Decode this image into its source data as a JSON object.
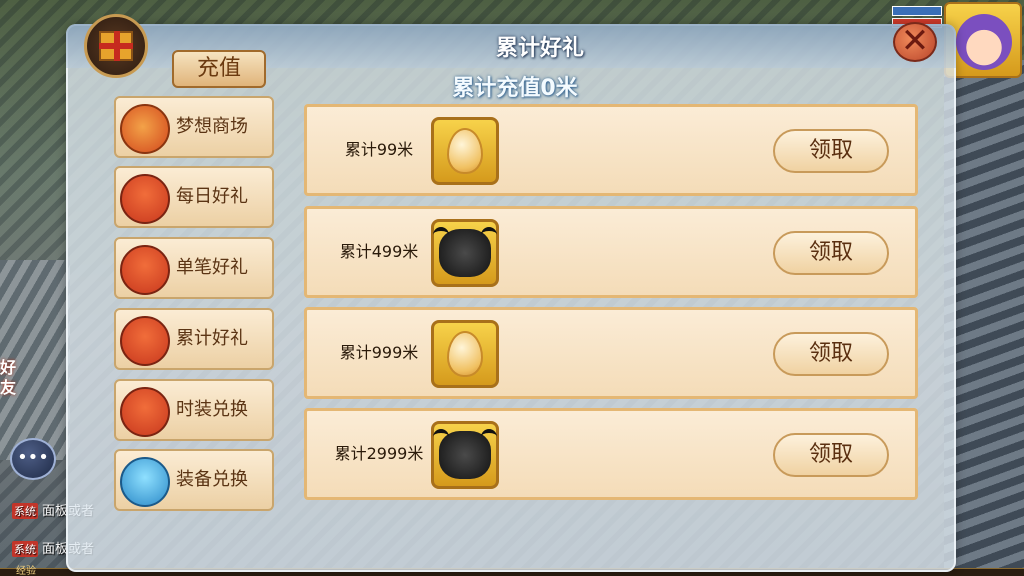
{
  "panel": {
    "title": "累计好礼",
    "tab_label": "充值",
    "total_label": "累计充值0米"
  },
  "menu": [
    {
      "label": "梦想商场",
      "icon": "lantern-icon"
    },
    {
      "label": "每日好礼",
      "icon": "gift-bag-icon"
    },
    {
      "label": "单笔好礼",
      "icon": "gift-bag-icon"
    },
    {
      "label": "累计好礼",
      "icon": "gift-bag-icon"
    },
    {
      "label": "时装兑换",
      "icon": "gift-bag-icon"
    },
    {
      "label": "装备兑换",
      "icon": "blue-bag-icon"
    }
  ],
  "rewards": [
    {
      "amount": "累计99米",
      "item_icon": "egg-icon",
      "claim_label": "领取"
    },
    {
      "amount": "累计499米",
      "item_icon": "bull-mount-icon",
      "claim_label": "领取"
    },
    {
      "amount": "累计999米",
      "item_icon": "egg-icon",
      "claim_label": "领取"
    },
    {
      "amount": "累计2999米",
      "item_icon": "bull-mount-icon",
      "claim_label": "领取"
    }
  ],
  "sidebar": {
    "friend_label_1": "好",
    "friend_label_2": "友"
  },
  "chat": {
    "line1_tag": "系统",
    "line1_text": "面板或者",
    "line2_tag": "系统",
    "line2_text": "面板或者"
  },
  "hud": {
    "xp_label": "经验"
  },
  "colors": {
    "panel_bg": "#dee8f0",
    "row_border": "#e4b774",
    "title_text": "#ffffff",
    "close_btn": "#d2542e"
  }
}
